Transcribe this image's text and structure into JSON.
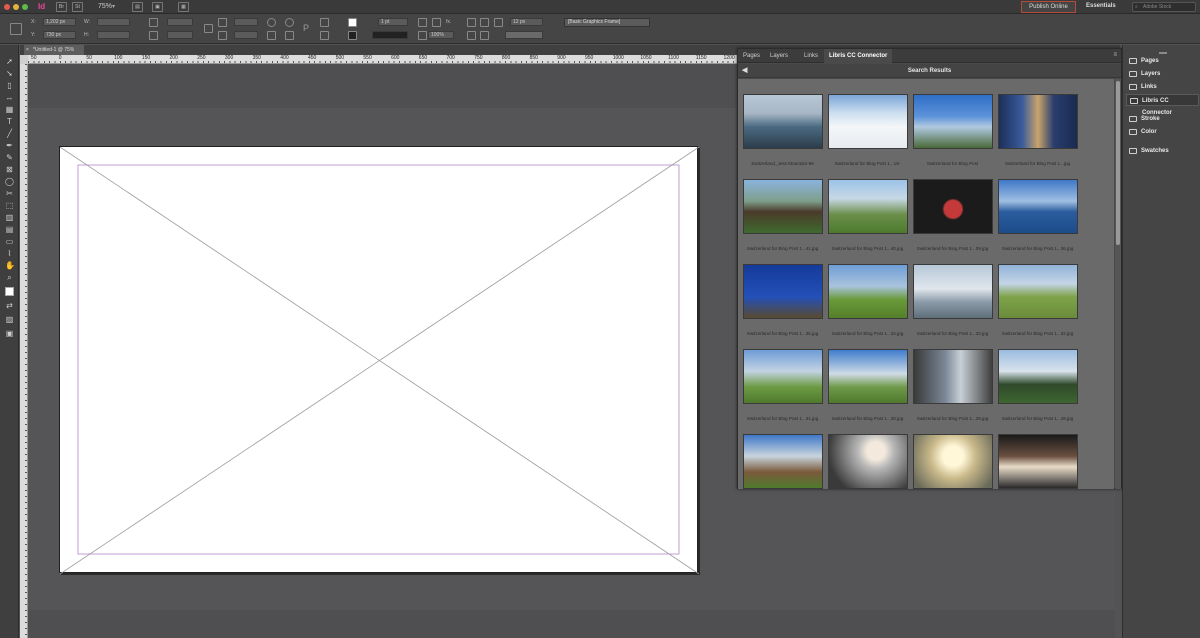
{
  "app": {
    "logo_text": "Id",
    "zoom": "75%",
    "publish_online": "Publish Online",
    "workspace": "Essentials",
    "search_placeholder": "Adobe Stock"
  },
  "controlbar": {
    "x_value": "1,202 px",
    "y_value": "730 px",
    "stroke_weight": "1 pt",
    "opacity": "100%",
    "gutter": "12 px",
    "frame_style": "[Basic Graphics Frame]"
  },
  "document": {
    "tab_title": "*Untitled-1 @ 75%"
  },
  "ruler": {
    "marks": [
      "50",
      "0",
      "50",
      "100",
      "150",
      "200",
      "250",
      "300",
      "350",
      "400",
      "450",
      "500",
      "550",
      "600",
      "650",
      "700",
      "750",
      "800",
      "850",
      "900",
      "950",
      "1000",
      "1050",
      "1100",
      "1150",
      "1200",
      "1250"
    ]
  },
  "panel": {
    "tabs": [
      "Pages",
      "Layers",
      "Links",
      "Libris CC Connector"
    ],
    "active_tab": "Libris CC Connector",
    "header": "Search Results",
    "results": [
      {
        "caption": "Switzerland_Jess Mountain-96",
        "image": "sky1"
      },
      {
        "caption": "Switzerland for Blog Post 1...19-",
        "image": "snow"
      },
      {
        "caption": "Switzerland for Blog Post",
        "image": "para"
      },
      {
        "caption": "Switzerland for Blog Post 1...jpg",
        "image": "city"
      },
      {
        "caption": "Switzerland for Blog Post 1...41.jpg",
        "image": "chalet"
      },
      {
        "caption": "Switzerland for Blog Post 1...40.jpg",
        "image": "valley"
      },
      {
        "caption": "Switzerland for Blog Post 1...09.jpg",
        "image": "dark538"
      },
      {
        "caption": "Switzerland for Blog Post 1...36.jpg",
        "image": "lake"
      },
      {
        "caption": "Switzerland for Blog Post 1...35.jpg",
        "image": "sign"
      },
      {
        "caption": "Switzerland for Blog Post 1...34.jpg",
        "image": "green"
      },
      {
        "caption": "Switzerland for Blog Post 1...33.jpg",
        "image": "peak"
      },
      {
        "caption": "Switzerland for Blog Post 1...32.jpg",
        "image": "path"
      },
      {
        "caption": "Switzerland for Blog Post 1...31.jpg",
        "image": "mtn"
      },
      {
        "caption": "Switzerland for Blog Post 1...30.jpg",
        "image": "para2"
      },
      {
        "caption": "Switzerland for Blog Post 1...29.jpg",
        "image": "people"
      },
      {
        "caption": "Switzerland for Blog Post 1...28.jpg",
        "image": "forest"
      },
      {
        "caption": "",
        "image": "cabin"
      },
      {
        "caption": "",
        "image": "sunset"
      },
      {
        "caption": "",
        "image": "wine"
      },
      {
        "caption": "",
        "image": "hotel"
      }
    ]
  },
  "dock": {
    "items": [
      "Pages",
      "Layers",
      "Links",
      "Libris CC Connector",
      "Stroke",
      "Color",
      "Swatches"
    ],
    "active": "Libris CC Connector"
  },
  "colors": {
    "accent_publish_border": "#b64a3a",
    "page_margin": "#d080c8",
    "page_column": "#a9a2d8"
  }
}
